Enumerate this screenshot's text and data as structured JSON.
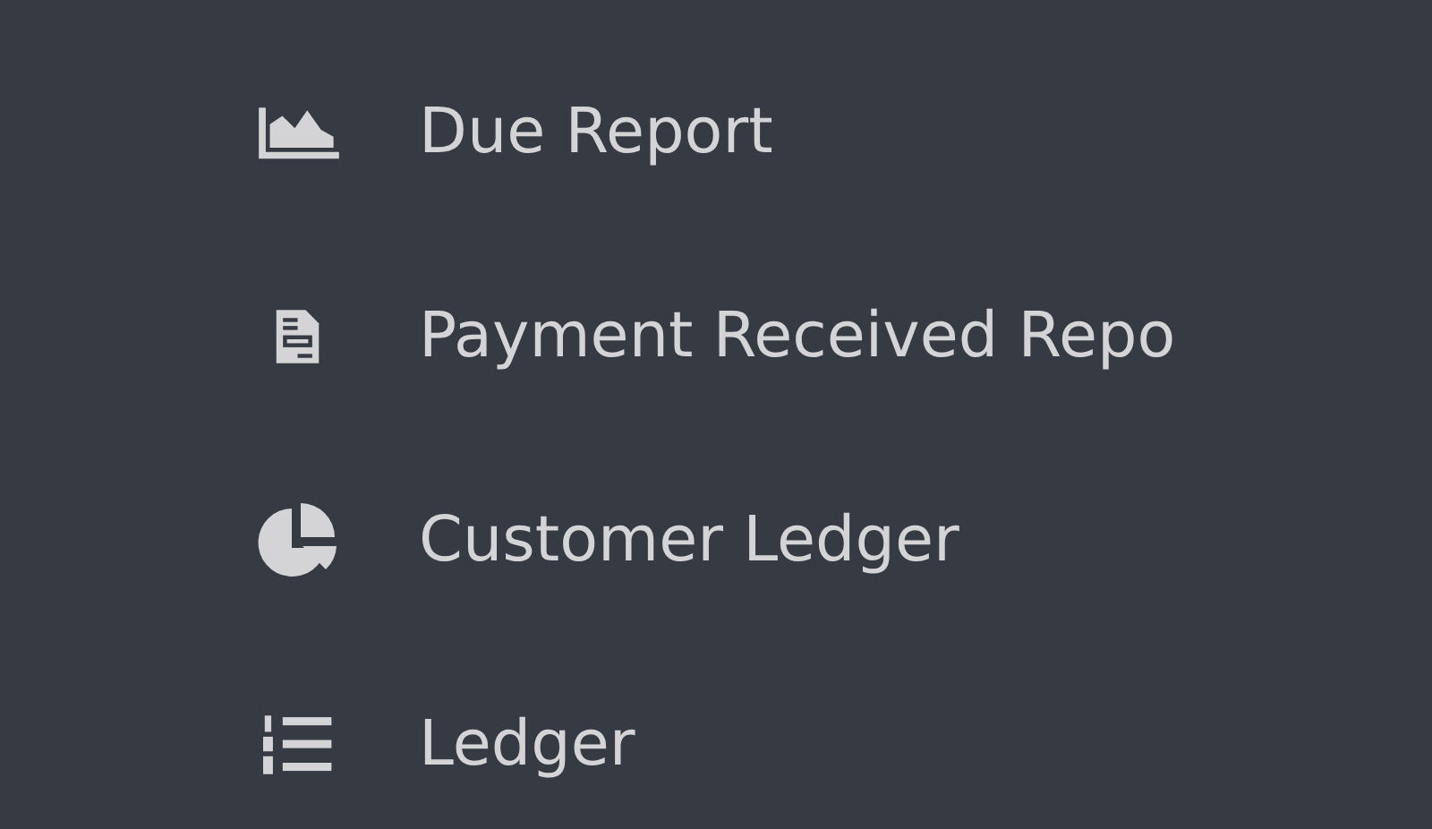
{
  "sidebar": {
    "items": [
      {
        "label": "Due Report"
      },
      {
        "label": "Payment Received Repo"
      },
      {
        "label": "Customer Ledger"
      },
      {
        "label": "Ledger"
      }
    ]
  }
}
